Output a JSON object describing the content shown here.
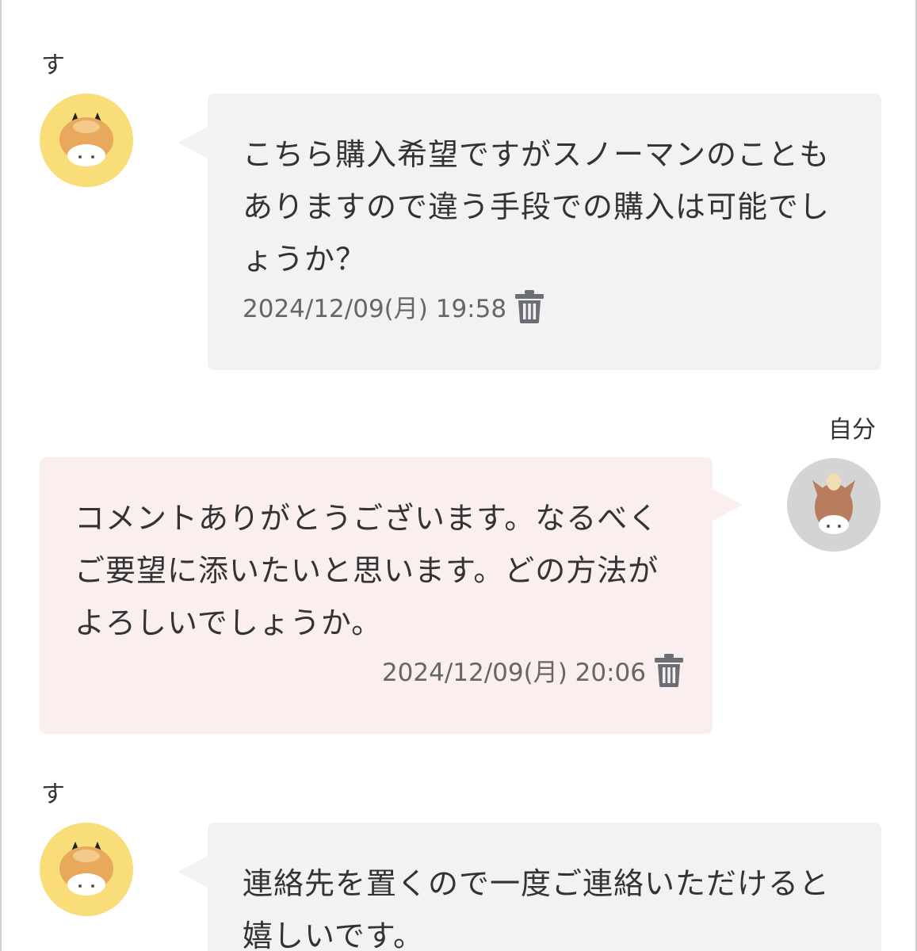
{
  "messages": [
    {
      "sender": "す",
      "direction": "incoming",
      "avatar": "cow-icon",
      "text": "こちら購入希望ですがスノーマンのこともありますので違う手段での購入は可能でしょうか？",
      "timestamp": "2024/12/09(月) 19:58"
    },
    {
      "sender": "自分",
      "direction": "outgoing",
      "avatar": "horse-icon",
      "text": "コメントありがとうございます。なるべくご要望に添いたいと思います。どの方法がよろしいでしょうか。",
      "timestamp": "2024/12/09(月) 20:06"
    },
    {
      "sender": "す",
      "direction": "incoming",
      "avatar": "cow-icon",
      "text": "連絡先を置くので一度ご連絡いただけると嬉しいです。"
    }
  ],
  "colors": {
    "incoming_bubble": "#f2f2f2",
    "outgoing_bubble": "#faeeee",
    "cow_avatar_bg": "#f8dd79",
    "horse_avatar_bg": "#d4d4d4",
    "icon_gray": "#6b6f75"
  }
}
